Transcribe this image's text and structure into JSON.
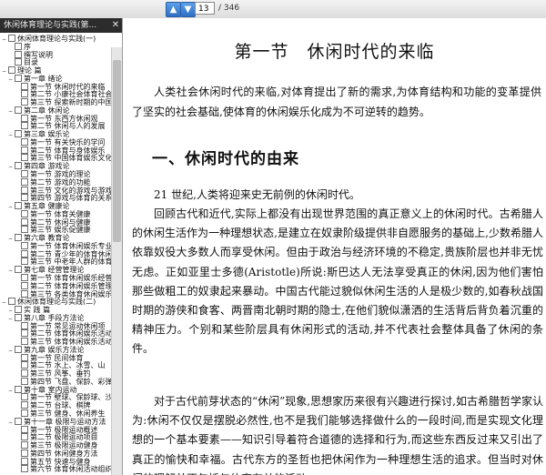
{
  "toolbar": {
    "prev_icon": "arrow-up-icon",
    "next_icon": "arrow-down-icon",
    "page_current": "13",
    "page_total": "/ 346"
  },
  "sidebar": {
    "tab_label": "休闲体育理论与实践(第...",
    "close_icon": "close-icon",
    "items": [
      {
        "text": "休闲体育理论与实践(一)",
        "toggle": "−",
        "level": 0
      },
      {
        "text": "序",
        "toggle": "",
        "level": 1
      },
      {
        "text": "撰写说明",
        "toggle": "",
        "level": 1
      },
      {
        "text": "目录",
        "toggle": "",
        "level": 1
      },
      {
        "text": "理论 篇",
        "toggle": "−",
        "level": 0
      },
      {
        "text": "第一章 绪论",
        "toggle": "−",
        "level": 1
      },
      {
        "text": "第一节 休闲时代的来临",
        "toggle": "",
        "level": 2
      },
      {
        "text": "第二节 小康社会体育社会",
        "toggle": "",
        "level": 2
      },
      {
        "text": "第三节 探索新时期的中国",
        "toggle": "",
        "level": 2
      },
      {
        "text": "第二章 休闲论",
        "toggle": "−",
        "level": 1
      },
      {
        "text": "第一节 东西方休闲观",
        "toggle": "",
        "level": 2
      },
      {
        "text": "第二节 休闲与人的发展",
        "toggle": "",
        "level": 2
      },
      {
        "text": "第三章 娱乐论",
        "toggle": "−",
        "level": 1
      },
      {
        "text": "第一节 有关快乐的学问",
        "toggle": "",
        "level": 2
      },
      {
        "text": "第二节 体育与身体娱乐",
        "toggle": "",
        "level": 2
      },
      {
        "text": "第三节 中国体育娱乐文化",
        "toggle": "",
        "level": 2
      },
      {
        "text": "第四章 游戏论",
        "toggle": "−",
        "level": 1
      },
      {
        "text": "第一节 游戏的理论",
        "toggle": "",
        "level": 2
      },
      {
        "text": "第二节 游戏的功能",
        "toggle": "",
        "level": 2
      },
      {
        "text": "第三节 文化的游戏与游戏",
        "toggle": "",
        "level": 2
      },
      {
        "text": "第四节 游戏与体育的关系",
        "toggle": "",
        "level": 2
      },
      {
        "text": "第五章 健康论",
        "toggle": "−",
        "level": 1
      },
      {
        "text": "第一节 体育关健康",
        "toggle": "",
        "level": 2
      },
      {
        "text": "第二节 休闲与健康",
        "toggle": "",
        "level": 2
      },
      {
        "text": "第三节 娱乐促健康",
        "toggle": "",
        "level": 2
      },
      {
        "text": "第六章 教育论",
        "toggle": "−",
        "level": 1
      },
      {
        "text": "第一节 体育休闲娱乐专业",
        "toggle": "",
        "level": 2
      },
      {
        "text": "第二节 青少年的体育休闲",
        "toggle": "",
        "level": 2
      },
      {
        "text": "第三节 中老年人群的体育",
        "toggle": "",
        "level": 2
      },
      {
        "text": "第七章 经营管理论",
        "toggle": "−",
        "level": 1
      },
      {
        "text": "第一节 体育休闲娱乐经营",
        "toggle": "",
        "level": 2
      },
      {
        "text": "第二节 体育休闲娱乐管理",
        "toggle": "",
        "level": 2
      },
      {
        "text": "第三节 各类体育休闲娱乐",
        "toggle": "",
        "level": 2
      },
      {
        "text": "休闲体育理论与实践(二)",
        "toggle": "−",
        "level": 0
      },
      {
        "text": "实 践 篇",
        "toggle": "−",
        "level": 1
      },
      {
        "text": "第八章 手段方法论",
        "toggle": "−",
        "level": 1
      },
      {
        "text": "第一节 常见运动休闲项",
        "toggle": "",
        "level": 2
      },
      {
        "text": "第二节 体育休闲娱乐活动",
        "toggle": "",
        "level": 2
      },
      {
        "text": "第三节 体育休闲娱乐活动",
        "toggle": "",
        "level": 2
      },
      {
        "text": "第九章 娱乐方法论",
        "toggle": "−",
        "level": 1
      },
      {
        "text": "第一节 民间体育",
        "toggle": "",
        "level": 2
      },
      {
        "text": "第二节 水上、冰雪、山",
        "toggle": "",
        "level": 2
      },
      {
        "text": "第三节 风筝、垂钓",
        "toggle": "",
        "level": 2
      },
      {
        "text": "第四节 飞盘、保龄、彩弹",
        "toggle": "",
        "level": 2
      },
      {
        "text": "第十章 室内运动",
        "toggle": "−",
        "level": 1
      },
      {
        "text": "第一节 壁球、保龄球、沙",
        "toggle": "",
        "level": 2
      },
      {
        "text": "第二节 台球、棋牌",
        "toggle": "",
        "level": 2
      },
      {
        "text": "第三节 健身、休闲养生",
        "toggle": "",
        "level": 2
      },
      {
        "text": "第十一章 极限与运动方法",
        "toggle": "−",
        "level": 1
      },
      {
        "text": "第一节 极限运动概述",
        "toggle": "",
        "level": 2
      },
      {
        "text": "第二节 极限运动项目",
        "toggle": "",
        "level": 2
      },
      {
        "text": "第三节 极限运动健身",
        "toggle": "",
        "level": 2
      },
      {
        "text": "第四节 休闲健身方法",
        "toggle": "",
        "level": 2
      },
      {
        "text": "第五节 快速与健身",
        "toggle": "",
        "level": 2
      },
      {
        "text": "第六节 体育休闲活动组织",
        "toggle": "",
        "level": 2
      }
    ]
  },
  "document": {
    "section_title": "第一节　休闲时代的来临",
    "intro": "人类社会休闲时代的来临,对体育提出了新的需求,为体育结构和功能的变革提供了坚实的社会基础,使体育的休闲娱乐化成为不可逆转的趋势。",
    "heading1": "一、休闲时代的由来",
    "paragraphs": [
      "21 世纪,人类将迎来史无前例的休闲时代。",
      "回顾古代和近代,实际上都没有出现世界范围的真正意义上的休闲时代。古希腊人的休闲生活作为一种理想状态,是建立在奴隶阶级提供非自愿服务的基础上,少数希腊人依靠奴役大多数人而享受休闲。但由于政治与经济环境的不稳定,贵族阶层也并非无忧无虑。正如亚里士多德(Aristotle)所说:斯巴达人无法享受真正的休闲,因为他们害怕那些做粗工的奴隶起来暴动。中国古代能过貌似休闲生活的人是极少数的,如春秋战国时期的游侠和食客、两晋南北朝时期的隐士,在他们貌似潇洒的生活背后背负着沉重的精神压力。个别和某些阶层具有休闲形式的活动,并不代表社会整体具备了休闲的条件。",
      "对于古代前芽状态的“休闲”现象,思想家历来很有兴趣进行探讨,如古希腊哲学家认为:休闲不仅仅是摆脱必然性,也不是我们能够选择做什么的一段时间,而是实现文化理想的一个基本要素——知识引导着符合道德的选择和行为,而这些东西反过来又引出了真正的愉快和幸福。古代东方的圣哲也把休闲作为一种理想生活的追求。但当时对休闲的理解并不包括与体育有关的活动。"
    ]
  }
}
